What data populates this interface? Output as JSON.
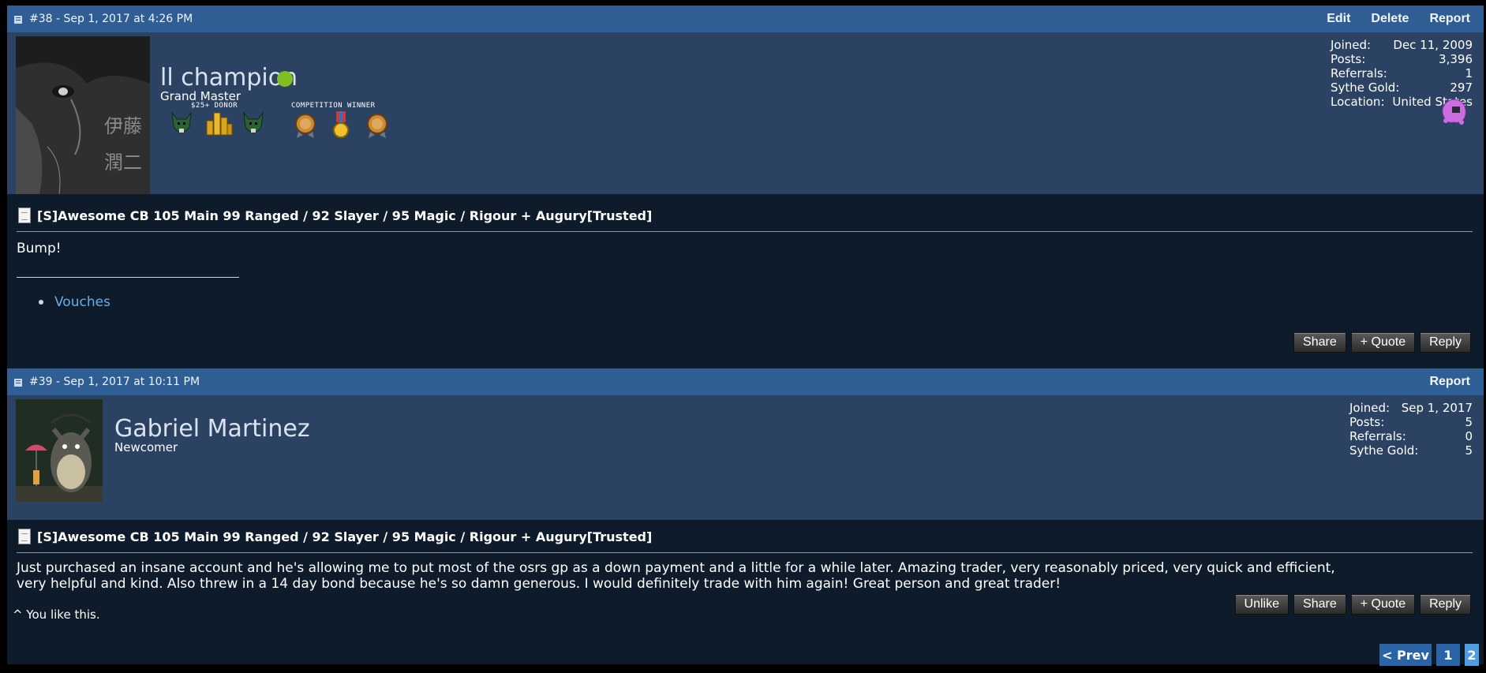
{
  "posts": [
    {
      "header": {
        "meta": "#38 - Sep 1, 2017 at 4:26 PM",
        "actions": [
          "Edit",
          "Delete",
          "Report"
        ]
      },
      "user": {
        "name": "ll champion",
        "title": "Grand Master",
        "online": true,
        "avatar_text": "伊藤\n潤二",
        "badges": {
          "donor_label": "$25+ DONOR",
          "competition_label": "COMPETITION WINNER"
        }
      },
      "stats": [
        {
          "k": "Joined:",
          "v": "Dec 11, 2009"
        },
        {
          "k": "Posts:",
          "v": "3,396"
        },
        {
          "k": "Referrals:",
          "v": "1"
        },
        {
          "k": "Sythe Gold:",
          "v": "297"
        },
        {
          "k": "Location:",
          "v": "United States"
        }
      ],
      "thread_title": "[S]Awesome CB 105 Main 99 Ranged / 92 Slayer / 95 Magic / Rigour + Augury[Trusted]",
      "body": "Bump!",
      "signature_link": "Vouches",
      "buttons": [
        "Share",
        "+ Quote",
        "Reply"
      ]
    },
    {
      "header": {
        "meta": "#39 - Sep 1, 2017 at 10:11 PM",
        "actions": [
          "Report"
        ]
      },
      "user": {
        "name": "Gabriel Martinez",
        "title": "Newcomer"
      },
      "stats": [
        {
          "k": "Joined:",
          "v": "Sep 1, 2017"
        },
        {
          "k": "Posts:",
          "v": "5"
        },
        {
          "k": "Referrals:",
          "v": "0"
        },
        {
          "k": "Sythe Gold:",
          "v": "5"
        }
      ],
      "thread_title": "[S]Awesome CB 105 Main 99 Ranged / 92 Slayer / 95 Magic / Rigour + Augury[Trusted]",
      "body_line1": "Just purchased an insane account and he's allowing me to put most of the osrs gp as a down payment and a little for a while later. Amazing trader, very reasonably priced, very quick and efficient,",
      "body_line2": "very helpful and kind. Also threw in a 14 day bond because he's so damn generous. I would definitely trade with him again! Great person and great trader!",
      "liked_text": "^ You like this.",
      "buttons": [
        "Unlike",
        "Share",
        "+ Quote",
        "Reply"
      ]
    }
  ],
  "pagination": {
    "prev": "< Prev",
    "pages": [
      "1",
      "2"
    ],
    "current": "2"
  },
  "colors": {
    "header_blue": "#2e5e94",
    "user_bar": "#2b4262",
    "body_bg": "#0d1b2a",
    "link": "#6aaee6",
    "online": "#7fbf1f"
  }
}
